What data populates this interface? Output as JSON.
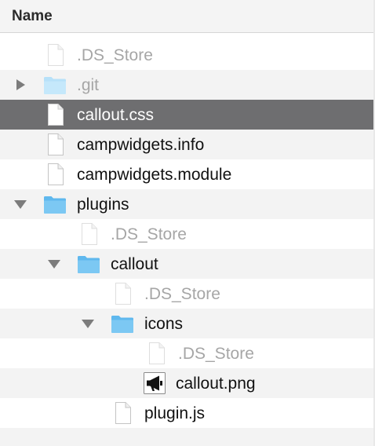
{
  "header": {
    "name_label": "Name"
  },
  "rows": [
    {
      "label": ".DS_Store",
      "type": "file",
      "state": "hidden"
    },
    {
      "label": ".git",
      "type": "folder",
      "state": "hidden",
      "disclosure": "collapsed"
    },
    {
      "label": "callout.css",
      "type": "file",
      "state": "selected"
    },
    {
      "label": "campwidgets.info",
      "type": "file",
      "state": "normal"
    },
    {
      "label": "campwidgets.module",
      "type": "file",
      "state": "normal"
    },
    {
      "label": "plugins",
      "type": "folder",
      "state": "normal",
      "disclosure": "expanded"
    },
    {
      "label": ".DS_Store",
      "type": "file",
      "state": "hidden"
    },
    {
      "label": "callout",
      "type": "folder",
      "state": "normal",
      "disclosure": "expanded"
    },
    {
      "label": ".DS_Store",
      "type": "file",
      "state": "hidden"
    },
    {
      "label": "icons",
      "type": "folder",
      "state": "normal",
      "disclosure": "expanded"
    },
    {
      "label": ".DS_Store",
      "type": "file",
      "state": "hidden"
    },
    {
      "label": "callout.png",
      "type": "image-file",
      "icon": "megaphone-icon",
      "state": "normal"
    },
    {
      "label": "plugin.js",
      "type": "file",
      "state": "normal"
    }
  ],
  "colors": {
    "selection": "#6e6e70",
    "folder": "#7cc8f3",
    "dim_text": "#a6a6a6",
    "stripe": "#f3f3f3"
  }
}
